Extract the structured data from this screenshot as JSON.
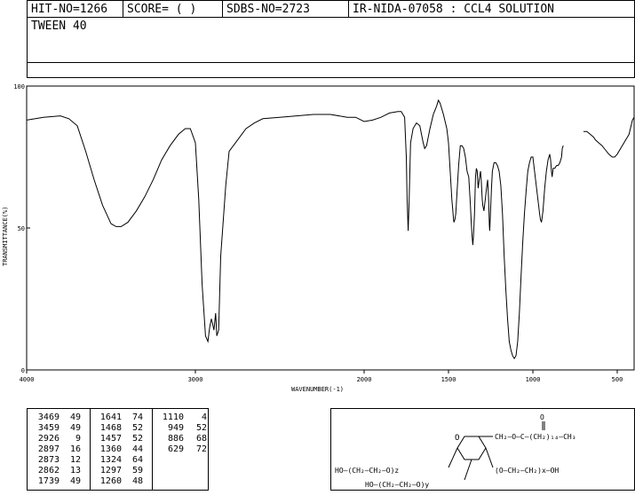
{
  "header": {
    "hit_no": "HIT-NO=1266",
    "score": "SCORE=  (   )",
    "sdbs_no": "SDBS-NO=2723",
    "ir_id": "IR-NIDA-07058 : CCL4 SOLUTION",
    "compound": "TWEEN 40"
  },
  "chart_data": {
    "type": "line",
    "xlabel": "WAVENUMBER(-1)",
    "ylabel": "TRANSMITTANCE(%)",
    "xlim": [
      4000,
      400
    ],
    "ylim": [
      0,
      100
    ],
    "x_ticks": [
      4000,
      3000,
      2000,
      1500,
      1000,
      500
    ],
    "y_ticks": [
      0,
      50,
      100
    ],
    "x_tick_labels": [
      "4000",
      "3000",
      "2000",
      "1500",
      "1000",
      "500"
    ],
    "y_tick_labels": [
      "0",
      "50",
      "100"
    ],
    "grid": false,
    "series": [
      {
        "values": [
          [
            4000,
            88
          ],
          [
            3900,
            89
          ],
          [
            3800,
            89.5
          ],
          [
            3750,
            88.5
          ],
          [
            3700,
            86
          ],
          [
            3650,
            77
          ],
          [
            3600,
            67
          ],
          [
            3550,
            58
          ],
          [
            3500,
            51.5
          ],
          [
            3470,
            50.5
          ],
          [
            3440,
            50.5
          ],
          [
            3400,
            52
          ],
          [
            3350,
            56
          ],
          [
            3300,
            61
          ],
          [
            3250,
            67
          ],
          [
            3200,
            74
          ],
          [
            3150,
            79
          ],
          [
            3100,
            83
          ],
          [
            3060,
            85
          ],
          [
            3030,
            85
          ],
          [
            3000,
            80
          ],
          [
            2980,
            60
          ],
          [
            2960,
            30
          ],
          [
            2940,
            12
          ],
          [
            2926,
            10
          ],
          [
            2915,
            15
          ],
          [
            2905,
            18
          ],
          [
            2897,
            16
          ],
          [
            2890,
            14
          ],
          [
            2880,
            20
          ],
          [
            2873,
            12
          ],
          [
            2862,
            14
          ],
          [
            2850,
            40
          ],
          [
            2820,
            65
          ],
          [
            2800,
            77
          ],
          [
            2750,
            81
          ],
          [
            2700,
            85
          ],
          [
            2650,
            87
          ],
          [
            2600,
            88.5
          ],
          [
            2500,
            89
          ],
          [
            2400,
            89.5
          ],
          [
            2300,
            90
          ],
          [
            2200,
            90
          ],
          [
            2100,
            89
          ],
          [
            2050,
            89
          ],
          [
            2000,
            87.5
          ],
          [
            1950,
            88
          ],
          [
            1900,
            89
          ],
          [
            1850,
            90.5
          ],
          [
            1800,
            91
          ],
          [
            1780,
            91
          ],
          [
            1760,
            89
          ],
          [
            1750,
            75
          ],
          [
            1745,
            60
          ],
          [
            1739,
            49
          ],
          [
            1733,
            60
          ],
          [
            1725,
            80
          ],
          [
            1710,
            85
          ],
          [
            1690,
            87
          ],
          [
            1670,
            86
          ],
          [
            1650,
            80
          ],
          [
            1641,
            78
          ],
          [
            1630,
            79
          ],
          [
            1610,
            85
          ],
          [
            1590,
            90
          ],
          [
            1570,
            93
          ],
          [
            1560,
            95
          ],
          [
            1550,
            94
          ],
          [
            1530,
            90
          ],
          [
            1510,
            85
          ],
          [
            1500,
            80
          ],
          [
            1490,
            70
          ],
          [
            1480,
            60
          ],
          [
            1470,
            53
          ],
          [
            1468,
            52
          ],
          [
            1462,
            53
          ],
          [
            1457,
            55
          ],
          [
            1450,
            62
          ],
          [
            1440,
            72
          ],
          [
            1430,
            79
          ],
          [
            1420,
            79
          ],
          [
            1410,
            78
          ],
          [
            1400,
            75
          ],
          [
            1390,
            70
          ],
          [
            1380,
            68
          ],
          [
            1370,
            58
          ],
          [
            1365,
            52
          ],
          [
            1360,
            47
          ],
          [
            1356,
            44
          ],
          [
            1352,
            47
          ],
          [
            1346,
            55
          ],
          [
            1340,
            68
          ],
          [
            1335,
            71
          ],
          [
            1330,
            70
          ],
          [
            1324,
            64
          ],
          [
            1318,
            67
          ],
          [
            1310,
            70
          ],
          [
            1305,
            66
          ],
          [
            1300,
            60
          ],
          [
            1297,
            58
          ],
          [
            1290,
            56
          ],
          [
            1282,
            60
          ],
          [
            1275,
            64
          ],
          [
            1268,
            67
          ],
          [
            1262,
            60
          ],
          [
            1258,
            51
          ],
          [
            1256,
            49
          ],
          [
            1252,
            54
          ],
          [
            1245,
            64
          ],
          [
            1240,
            70
          ],
          [
            1230,
            73
          ],
          [
            1220,
            73
          ],
          [
            1210,
            72
          ],
          [
            1200,
            70
          ],
          [
            1190,
            65
          ],
          [
            1180,
            55
          ],
          [
            1170,
            40
          ],
          [
            1160,
            28
          ],
          [
            1150,
            18
          ],
          [
            1140,
            10
          ],
          [
            1130,
            7
          ],
          [
            1120,
            5
          ],
          [
            1110,
            4
          ],
          [
            1100,
            5
          ],
          [
            1090,
            10
          ],
          [
            1080,
            20
          ],
          [
            1070,
            33
          ],
          [
            1060,
            45
          ],
          [
            1050,
            55
          ],
          [
            1040,
            63
          ],
          [
            1030,
            70
          ],
          [
            1020,
            73
          ],
          [
            1010,
            75
          ],
          [
            1000,
            75
          ],
          [
            990,
            70
          ],
          [
            980,
            65
          ],
          [
            970,
            60
          ],
          [
            960,
            55
          ],
          [
            955,
            53
          ],
          [
            949,
            52
          ],
          [
            940,
            56
          ],
          [
            930,
            64
          ],
          [
            920,
            70
          ],
          [
            910,
            74
          ],
          [
            900,
            76
          ],
          [
            895,
            74
          ],
          [
            890,
            70
          ],
          [
            886,
            68
          ],
          [
            880,
            71
          ],
          [
            870,
            71
          ],
          [
            860,
            72
          ],
          [
            850,
            72
          ],
          [
            840,
            73
          ],
          [
            830,
            75
          ],
          [
            826,
            78
          ],
          [
            820,
            79
          ]
        ]
      },
      {
        "values": [
          [
            700,
            84
          ],
          [
            680,
            84
          ],
          [
            660,
            83
          ],
          [
            640,
            82
          ],
          [
            629,
            81
          ],
          [
            610,
            80
          ],
          [
            590,
            79
          ],
          [
            570,
            77.5
          ],
          [
            550,
            76
          ],
          [
            530,
            75
          ],
          [
            515,
            75
          ],
          [
            500,
            76
          ],
          [
            480,
            78
          ],
          [
            460,
            80
          ],
          [
            450,
            81
          ],
          [
            440,
            82
          ],
          [
            430,
            83
          ],
          [
            420,
            85.5
          ],
          [
            410,
            88
          ],
          [
            400,
            89
          ]
        ]
      }
    ]
  },
  "peak_table": {
    "columns": [
      [
        [
          "3469",
          "49"
        ],
        [
          "3459",
          "49"
        ],
        [
          "2926",
          "9"
        ],
        [
          "2897",
          "16"
        ],
        [
          "2873",
          "12"
        ],
        [
          "2862",
          "13"
        ],
        [
          "1739",
          "49"
        ]
      ],
      [
        [
          "1641",
          "74"
        ],
        [
          "1468",
          "52"
        ],
        [
          "1457",
          "52"
        ],
        [
          "1360",
          "44"
        ],
        [
          "1324",
          "64"
        ],
        [
          "1297",
          "59"
        ],
        [
          "1260",
          "48"
        ]
      ],
      [
        [
          "1110",
          "4"
        ],
        [
          "949",
          "52"
        ],
        [
          "886",
          "68"
        ],
        [
          "629",
          "72"
        ]
      ]
    ]
  },
  "structure": {
    "labels": {
      "top_chain": "CH₂—O—C—(CH₂)₁₄—CH₃",
      "carbonyl": "O",
      "left_chain": "HO—(CH₂—CH₂—O)z",
      "right_chain": "(O—CH₂—CH₂)x—OH",
      "bottom_chain": "HO—(CH₂—CH₂—O)y",
      "ring_o": "O"
    }
  }
}
